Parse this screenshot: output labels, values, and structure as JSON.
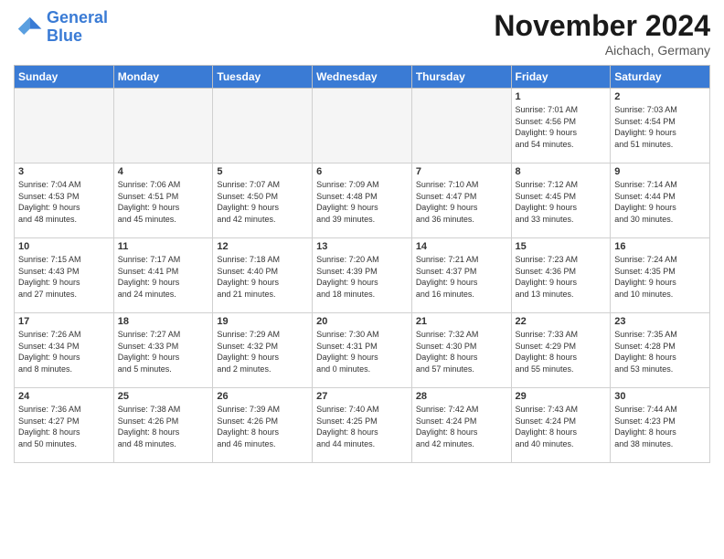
{
  "header": {
    "logo_line1": "General",
    "logo_line2": "Blue",
    "month": "November 2024",
    "location": "Aichach, Germany"
  },
  "days_of_week": [
    "Sunday",
    "Monday",
    "Tuesday",
    "Wednesday",
    "Thursday",
    "Friday",
    "Saturday"
  ],
  "weeks": [
    [
      {
        "day": "",
        "info": "",
        "empty": true
      },
      {
        "day": "",
        "info": "",
        "empty": true
      },
      {
        "day": "",
        "info": "",
        "empty": true
      },
      {
        "day": "",
        "info": "",
        "empty": true
      },
      {
        "day": "",
        "info": "",
        "empty": true
      },
      {
        "day": "1",
        "info": "Sunrise: 7:01 AM\nSunset: 4:56 PM\nDaylight: 9 hours\nand 54 minutes.",
        "empty": false
      },
      {
        "day": "2",
        "info": "Sunrise: 7:03 AM\nSunset: 4:54 PM\nDaylight: 9 hours\nand 51 minutes.",
        "empty": false
      }
    ],
    [
      {
        "day": "3",
        "info": "Sunrise: 7:04 AM\nSunset: 4:53 PM\nDaylight: 9 hours\nand 48 minutes.",
        "empty": false
      },
      {
        "day": "4",
        "info": "Sunrise: 7:06 AM\nSunset: 4:51 PM\nDaylight: 9 hours\nand 45 minutes.",
        "empty": false
      },
      {
        "day": "5",
        "info": "Sunrise: 7:07 AM\nSunset: 4:50 PM\nDaylight: 9 hours\nand 42 minutes.",
        "empty": false
      },
      {
        "day": "6",
        "info": "Sunrise: 7:09 AM\nSunset: 4:48 PM\nDaylight: 9 hours\nand 39 minutes.",
        "empty": false
      },
      {
        "day": "7",
        "info": "Sunrise: 7:10 AM\nSunset: 4:47 PM\nDaylight: 9 hours\nand 36 minutes.",
        "empty": false
      },
      {
        "day": "8",
        "info": "Sunrise: 7:12 AM\nSunset: 4:45 PM\nDaylight: 9 hours\nand 33 minutes.",
        "empty": false
      },
      {
        "day": "9",
        "info": "Sunrise: 7:14 AM\nSunset: 4:44 PM\nDaylight: 9 hours\nand 30 minutes.",
        "empty": false
      }
    ],
    [
      {
        "day": "10",
        "info": "Sunrise: 7:15 AM\nSunset: 4:43 PM\nDaylight: 9 hours\nand 27 minutes.",
        "empty": false
      },
      {
        "day": "11",
        "info": "Sunrise: 7:17 AM\nSunset: 4:41 PM\nDaylight: 9 hours\nand 24 minutes.",
        "empty": false
      },
      {
        "day": "12",
        "info": "Sunrise: 7:18 AM\nSunset: 4:40 PM\nDaylight: 9 hours\nand 21 minutes.",
        "empty": false
      },
      {
        "day": "13",
        "info": "Sunrise: 7:20 AM\nSunset: 4:39 PM\nDaylight: 9 hours\nand 18 minutes.",
        "empty": false
      },
      {
        "day": "14",
        "info": "Sunrise: 7:21 AM\nSunset: 4:37 PM\nDaylight: 9 hours\nand 16 minutes.",
        "empty": false
      },
      {
        "day": "15",
        "info": "Sunrise: 7:23 AM\nSunset: 4:36 PM\nDaylight: 9 hours\nand 13 minutes.",
        "empty": false
      },
      {
        "day": "16",
        "info": "Sunrise: 7:24 AM\nSunset: 4:35 PM\nDaylight: 9 hours\nand 10 minutes.",
        "empty": false
      }
    ],
    [
      {
        "day": "17",
        "info": "Sunrise: 7:26 AM\nSunset: 4:34 PM\nDaylight: 9 hours\nand 8 minutes.",
        "empty": false
      },
      {
        "day": "18",
        "info": "Sunrise: 7:27 AM\nSunset: 4:33 PM\nDaylight: 9 hours\nand 5 minutes.",
        "empty": false
      },
      {
        "day": "19",
        "info": "Sunrise: 7:29 AM\nSunset: 4:32 PM\nDaylight: 9 hours\nand 2 minutes.",
        "empty": false
      },
      {
        "day": "20",
        "info": "Sunrise: 7:30 AM\nSunset: 4:31 PM\nDaylight: 9 hours\nand 0 minutes.",
        "empty": false
      },
      {
        "day": "21",
        "info": "Sunrise: 7:32 AM\nSunset: 4:30 PM\nDaylight: 8 hours\nand 57 minutes.",
        "empty": false
      },
      {
        "day": "22",
        "info": "Sunrise: 7:33 AM\nSunset: 4:29 PM\nDaylight: 8 hours\nand 55 minutes.",
        "empty": false
      },
      {
        "day": "23",
        "info": "Sunrise: 7:35 AM\nSunset: 4:28 PM\nDaylight: 8 hours\nand 53 minutes.",
        "empty": false
      }
    ],
    [
      {
        "day": "24",
        "info": "Sunrise: 7:36 AM\nSunset: 4:27 PM\nDaylight: 8 hours\nand 50 minutes.",
        "empty": false
      },
      {
        "day": "25",
        "info": "Sunrise: 7:38 AM\nSunset: 4:26 PM\nDaylight: 8 hours\nand 48 minutes.",
        "empty": false
      },
      {
        "day": "26",
        "info": "Sunrise: 7:39 AM\nSunset: 4:26 PM\nDaylight: 8 hours\nand 46 minutes.",
        "empty": false
      },
      {
        "day": "27",
        "info": "Sunrise: 7:40 AM\nSunset: 4:25 PM\nDaylight: 8 hours\nand 44 minutes.",
        "empty": false
      },
      {
        "day": "28",
        "info": "Sunrise: 7:42 AM\nSunset: 4:24 PM\nDaylight: 8 hours\nand 42 minutes.",
        "empty": false
      },
      {
        "day": "29",
        "info": "Sunrise: 7:43 AM\nSunset: 4:24 PM\nDaylight: 8 hours\nand 40 minutes.",
        "empty": false
      },
      {
        "day": "30",
        "info": "Sunrise: 7:44 AM\nSunset: 4:23 PM\nDaylight: 8 hours\nand 38 minutes.",
        "empty": false
      }
    ]
  ]
}
